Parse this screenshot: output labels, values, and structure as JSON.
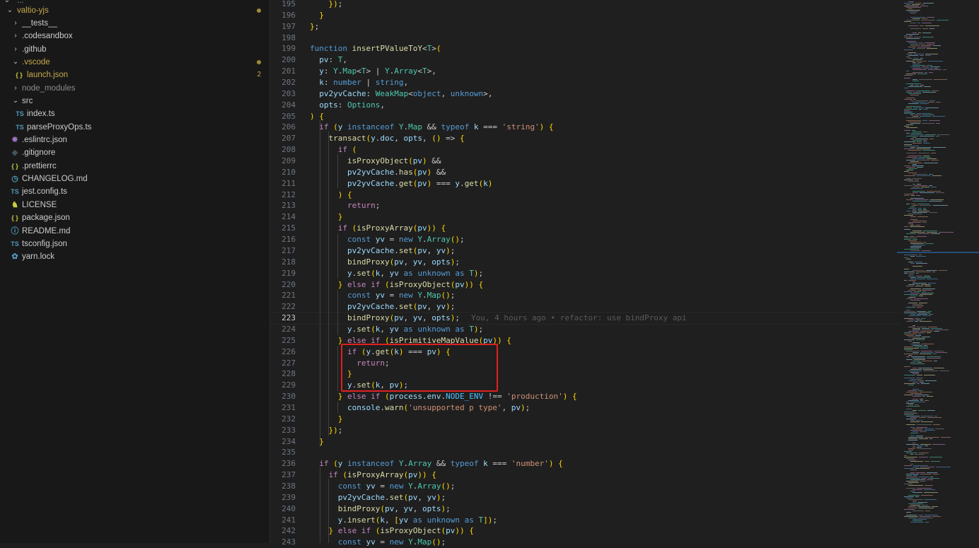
{
  "explorer": {
    "items": [
      {
        "label": "..."
      },
      {
        "label": "valtio-yjs"
      },
      {
        "label": "__tests__"
      },
      {
        "label": ".codesandbox"
      },
      {
        "label": ".github"
      },
      {
        "label": ".vscode"
      },
      {
        "label": "launch.json",
        "badge": "2"
      },
      {
        "label": "node_modules"
      },
      {
        "label": "src"
      },
      {
        "label": "index.ts"
      },
      {
        "label": "parseProxyOps.ts"
      },
      {
        "label": ".eslintrc.json"
      },
      {
        "label": ".gitignore"
      },
      {
        "label": ".prettierrc"
      },
      {
        "label": "CHANGELOG.md"
      },
      {
        "label": "jest.config.ts"
      },
      {
        "label": "LICENSE"
      },
      {
        "label": "package.json"
      },
      {
        "label": "README.md"
      },
      {
        "label": "tsconfig.json"
      },
      {
        "label": "yarn.lock"
      }
    ],
    "icons": {
      "ts": "TS",
      "json": "{ }"
    }
  },
  "editor": {
    "active_line": 223,
    "blame": "You, 4 hours ago • refactor: use bindProxy api",
    "lines": [
      {
        "n": "195",
        "t": "    });"
      },
      {
        "n": "196",
        "t": "  }"
      },
      {
        "n": "197",
        "t": "};"
      },
      {
        "n": "198",
        "t": ""
      },
      {
        "n": "199",
        "t": "function insertPValueToY<T>("
      },
      {
        "n": "200",
        "t": "  pv: T,"
      },
      {
        "n": "201",
        "t": "  y: Y.Map<T> | Y.Array<T>,"
      },
      {
        "n": "202",
        "t": "  k: number | string,"
      },
      {
        "n": "203",
        "t": "  pv2yvCache: WeakMap<object, unknown>,"
      },
      {
        "n": "204",
        "t": "  opts: Options,"
      },
      {
        "n": "205",
        "t": ") {"
      },
      {
        "n": "206",
        "t": "  if (y instanceof Y.Map && typeof k === 'string') {"
      },
      {
        "n": "207",
        "t": "    transact(y.doc, opts, () => {"
      },
      {
        "n": "208",
        "t": "      if ("
      },
      {
        "n": "209",
        "t": "        isProxyObject(pv) &&"
      },
      {
        "n": "210",
        "t": "        pv2yvCache.has(pv) &&"
      },
      {
        "n": "211",
        "t": "        pv2yvCache.get(pv) === y.get(k)"
      },
      {
        "n": "212",
        "t": "      ) {"
      },
      {
        "n": "213",
        "t": "        return;"
      },
      {
        "n": "214",
        "t": "      }"
      },
      {
        "n": "215",
        "t": "      if (isProxyArray(pv)) {"
      },
      {
        "n": "216",
        "t": "        const yv = new Y.Array();"
      },
      {
        "n": "217",
        "t": "        pv2yvCache.set(pv, yv);"
      },
      {
        "n": "218",
        "t": "        bindProxy(pv, yv, opts);"
      },
      {
        "n": "219",
        "t": "        y.set(k, yv as unknown as T);"
      },
      {
        "n": "220",
        "t": "      } else if (isProxyObject(pv)) {"
      },
      {
        "n": "221",
        "t": "        const yv = new Y.Map();"
      },
      {
        "n": "222",
        "t": "        pv2yvCache.set(pv, yv);"
      },
      {
        "n": "223",
        "t": "        bindProxy(pv, yv, opts);"
      },
      {
        "n": "224",
        "t": "        y.set(k, yv as unknown as T);"
      },
      {
        "n": "225",
        "t": "      } else if (isPrimitiveMapValue(pv)) {"
      },
      {
        "n": "226",
        "t": "        if (y.get(k) === pv) {"
      },
      {
        "n": "227",
        "t": "          return;"
      },
      {
        "n": "228",
        "t": "        }"
      },
      {
        "n": "229",
        "t": "        y.set(k, pv);"
      },
      {
        "n": "230",
        "t": "      } else if (process.env.NODE_ENV !== 'production') {"
      },
      {
        "n": "231",
        "t": "        console.warn('unsupported p type', pv);"
      },
      {
        "n": "232",
        "t": "      }"
      },
      {
        "n": "233",
        "t": "    });"
      },
      {
        "n": "234",
        "t": "  }"
      },
      {
        "n": "235",
        "t": ""
      },
      {
        "n": "236",
        "t": "  if (y instanceof Y.Array && typeof k === 'number') {"
      },
      {
        "n": "237",
        "t": "    if (isProxyArray(pv)) {"
      },
      {
        "n": "238",
        "t": "      const yv = new Y.Array();"
      },
      {
        "n": "239",
        "t": "      pv2yvCache.set(pv, yv);"
      },
      {
        "n": "240",
        "t": "      bindProxy(pv, yv, opts);"
      },
      {
        "n": "241",
        "t": "      y.insert(k, [yv as unknown as T]);"
      },
      {
        "n": "242",
        "t": "    } else if (isProxyObject(pv)) {"
      },
      {
        "n": "243",
        "t": "      const yv = new Y.Map();"
      }
    ]
  },
  "colors": {
    "sidebar_bg": "#181818",
    "editor_bg": "#1f1f1f",
    "highlight_box": "#e02020",
    "git_modified": "#c5a849"
  }
}
